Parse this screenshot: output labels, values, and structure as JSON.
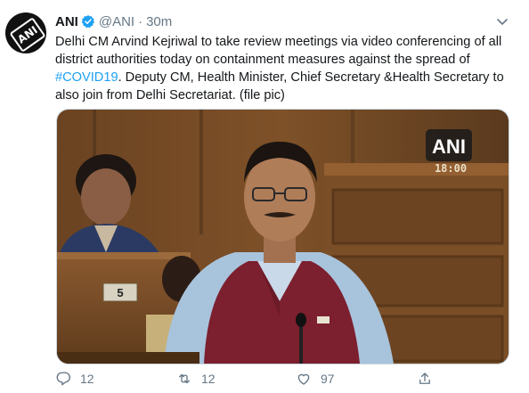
{
  "tweet": {
    "author_name": "ANI",
    "handle": "@ANI",
    "separator": "·",
    "time": "30m",
    "text_before": "Delhi CM Arvind Kejriwal to take review meetings via video conferencing of all district authorities today on containment measures against the spread of ",
    "hashtag": "#COVID19",
    "text_after": ". Deputy CM, Health Minister, Chief Secretary &Health Secretary to also join from Delhi Secretariat. (file pic)"
  },
  "avatar": {
    "logo_text": "ANI"
  },
  "media": {
    "watermark": "ANI",
    "timestamp": "18:00",
    "desk_number": "5"
  },
  "actions": {
    "reply_count": "12",
    "retweet_count": "12",
    "like_count": "97"
  },
  "colors": {
    "link": "#1da1f2",
    "muted": "#657786",
    "verified": "#1da1f2"
  },
  "icons": [
    "verified-badge-icon",
    "chevron-down-icon",
    "reply-icon",
    "retweet-icon",
    "like-icon",
    "share-icon"
  ]
}
